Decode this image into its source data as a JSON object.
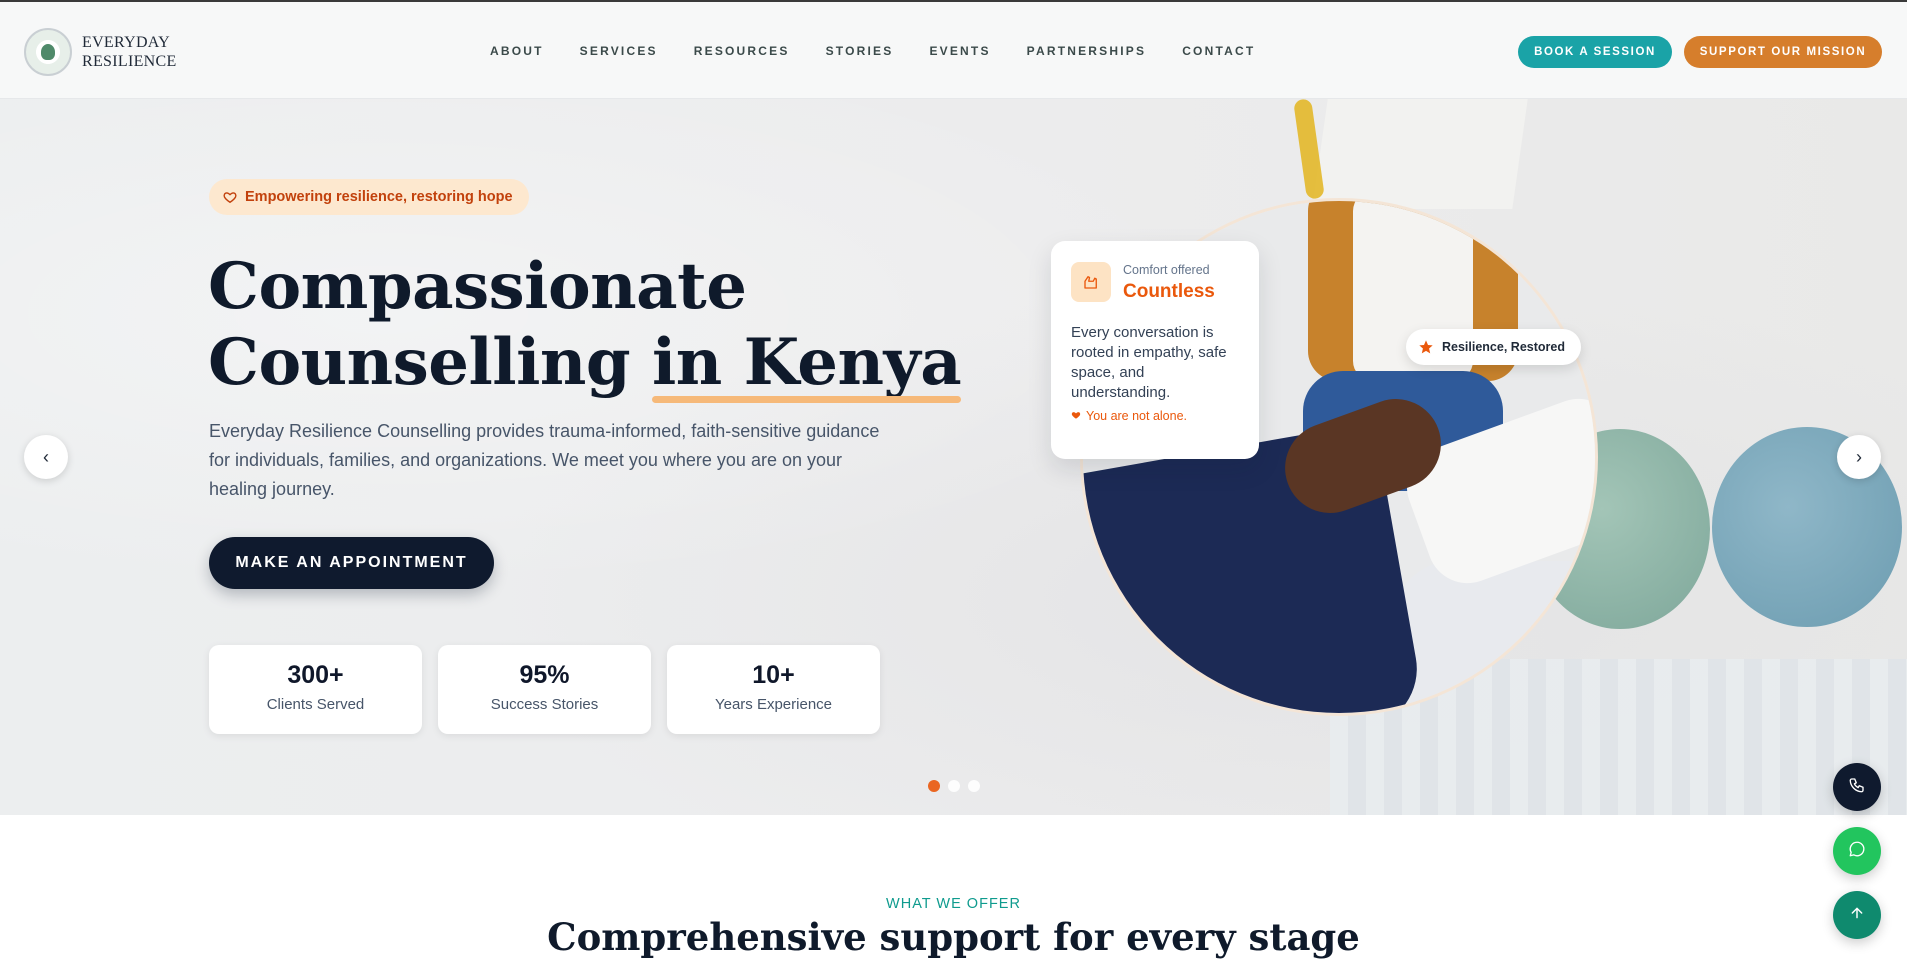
{
  "header": {
    "logo_text_line1": "EVERYDAY",
    "logo_text_line2": "RESILIENCE",
    "nav": [
      "ABOUT",
      "SERVICES",
      "RESOURCES",
      "STORIES",
      "EVENTS",
      "PARTNERSHIPS",
      "CONTACT"
    ],
    "book_label": "BOOK A SESSION",
    "support_label": "SUPPORT OUR MISSION"
  },
  "hero": {
    "tagline": "Empowering resilience, restoring hope",
    "title_line1": "Compassionate",
    "title_line2_a": "Counselling ",
    "title_line2_b": "in Kenya",
    "description": "Everyday Resilience Counselling provides trauma-informed, faith-sensitive guidance for individuals, families, and organizations. We meet you where you are on your healing journey.",
    "cta_label": "MAKE AN APPOINTMENT",
    "stats": [
      {
        "value": "300+",
        "label": "Clients Served"
      },
      {
        "value": "95%",
        "label": "Success Stories"
      },
      {
        "value": "10+",
        "label": "Years Experience"
      }
    ],
    "prev_label": "‹",
    "next_label": "›",
    "card": {
      "small": "Comfort offered",
      "big": "Countless",
      "text": "Every conversation is rooted in empathy, safe space, and understanding.",
      "note": "You are not alone."
    },
    "badge": "Resilience, Restored",
    "slides_total": 3,
    "slide_active": 1
  },
  "offer": {
    "eyebrow": "WHAT WE OFFER",
    "title": "Comprehensive support for every stage"
  },
  "colors": {
    "teal": "#1aa3a7",
    "orange": "#d67e2c",
    "navy": "#0f1a2e",
    "accent": "#ea580c"
  },
  "icons": {
    "tagline": "heart-icon",
    "card": "hands-icon",
    "note": "heart-icon",
    "badge": "star-icon",
    "fab_phone": "phone-icon",
    "fab_chat": "whatsapp-icon",
    "fab_top": "arrow-up-icon"
  }
}
